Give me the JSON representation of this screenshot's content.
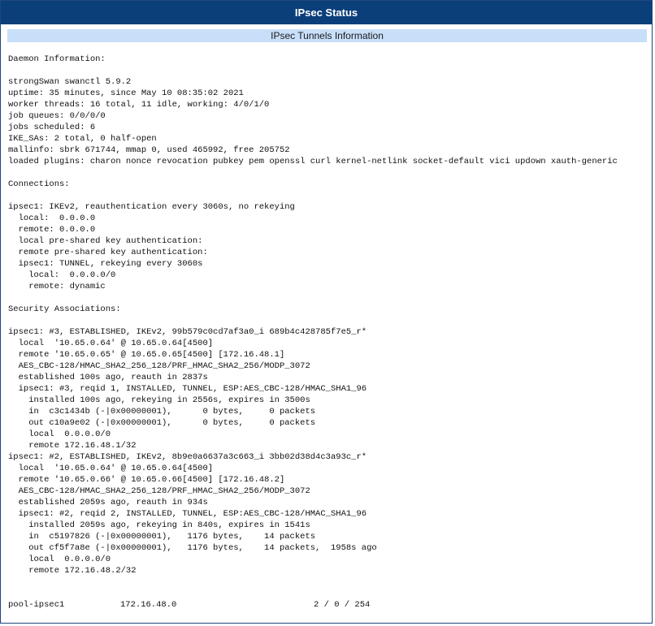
{
  "window": {
    "title": "IPsec Status"
  },
  "section": {
    "title": "IPsec Tunnels Information"
  },
  "status_output": "Daemon Information:\n\nstrongSwan swanctl 5.9.2\nuptime: 35 minutes, since May 10 08:35:02 2021\nworker threads: 16 total, 11 idle, working: 4/0/1/0\njob queues: 0/0/0/0\njobs scheduled: 6\nIKE_SAs: 2 total, 0 half-open\nmallinfo: sbrk 671744, mmap 0, used 465992, free 205752\nloaded plugins: charon nonce revocation pubkey pem openssl curl kernel-netlink socket-default vici updown xauth-generic\n\nConnections:\n\nipsec1: IKEv2, reauthentication every 3060s, no rekeying\n  local:  0.0.0.0\n  remote: 0.0.0.0\n  local pre-shared key authentication:\n  remote pre-shared key authentication:\n  ipsec1: TUNNEL, rekeying every 3060s\n    local:  0.0.0.0/0\n    remote: dynamic\n\nSecurity Associations:\n\nipsec1: #3, ESTABLISHED, IKEv2, 99b579c0cd7af3a0_i 689b4c428785f7e5_r*\n  local  '10.65.0.64' @ 10.65.0.64[4500]\n  remote '10.65.0.65' @ 10.65.0.65[4500] [172.16.48.1]\n  AES_CBC-128/HMAC_SHA2_256_128/PRF_HMAC_SHA2_256/MODP_3072\n  established 100s ago, reauth in 2837s\n  ipsec1: #3, reqid 1, INSTALLED, TUNNEL, ESP:AES_CBC-128/HMAC_SHA1_96\n    installed 100s ago, rekeying in 2556s, expires in 3500s\n    in  c3c1434b (-|0x00000001),      0 bytes,     0 packets\n    out c10a9e02 (-|0x00000001),      0 bytes,     0 packets\n    local  0.0.0.0/0\n    remote 172.16.48.1/32\nipsec1: #2, ESTABLISHED, IKEv2, 8b9e0a6637a3c663_i 3bb02d38d4c3a93c_r*\n  local  '10.65.0.64' @ 10.65.0.64[4500]\n  remote '10.65.0.66' @ 10.65.0.66[4500] [172.16.48.2]\n  AES_CBC-128/HMAC_SHA2_256_128/PRF_HMAC_SHA2_256/MODP_3072\n  established 2059s ago, reauth in 934s\n  ipsec1: #2, reqid 2, INSTALLED, TUNNEL, ESP:AES_CBC-128/HMAC_SHA1_96\n    installed 2059s ago, rekeying in 840s, expires in 1541s\n    in  c5197826 (-|0x00000001),   1176 bytes,    14 packets\n    out cf5f7a8e (-|0x00000001),   1176 bytes,    14 packets,  1958s ago\n    local  0.0.0.0/0\n    remote 172.16.48.2/32",
  "pool": {
    "name": "pool-ipsec1",
    "address": "172.16.48.0",
    "usage": "2 / 0 / 254"
  },
  "colors": {
    "titlebar_bg": "#0b3f7a",
    "section_header_bg": "#c8dffa"
  }
}
